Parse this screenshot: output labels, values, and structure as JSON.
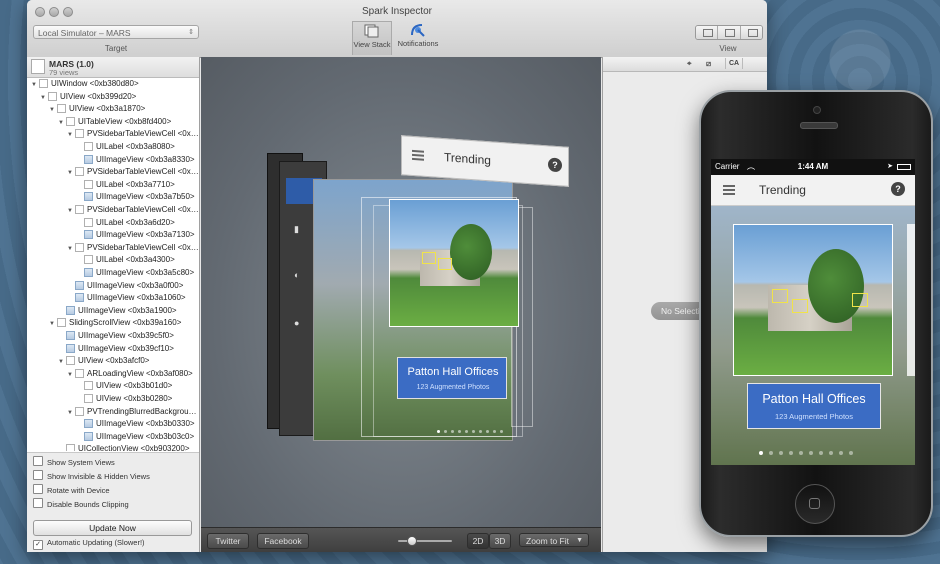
{
  "window": {
    "title": "Spark Inspector",
    "target_value": "Local Simulator – MARS",
    "target_label": "Target",
    "tool_view_stack": "View Stack",
    "tool_notifications": "Notifications",
    "view_label": "View"
  },
  "sidebar": {
    "app_name": "MARS (1.0)",
    "view_count": "79 views",
    "tree": [
      {
        "label": "UIWindow <0xb380d80>",
        "depth": 0,
        "expanded": true
      },
      {
        "label": "UIView <0xb399d20>",
        "depth": 1,
        "expanded": true
      },
      {
        "label": "UIView <0xb3a1870>",
        "depth": 2,
        "expanded": true
      },
      {
        "label": "UITableView <0xb8fd400>",
        "depth": 3,
        "expanded": true
      },
      {
        "label": "PVSidebarTableViewCell <0x…",
        "depth": 4,
        "expanded": true
      },
      {
        "label": "UILabel <0xb3a8080>",
        "depth": 5
      },
      {
        "label": "UIImageView <0xb3a8330>",
        "depth": 5,
        "img": true
      },
      {
        "label": "PVSidebarTableViewCell <0x…",
        "depth": 4,
        "expanded": true
      },
      {
        "label": "UILabel <0xb3a7710>",
        "depth": 5
      },
      {
        "label": "UIImageView <0xb3a7b50>",
        "depth": 5,
        "img": true
      },
      {
        "label": "PVSidebarTableViewCell <0x…",
        "depth": 4,
        "expanded": true
      },
      {
        "label": "UILabel <0xb3a6d20>",
        "depth": 5
      },
      {
        "label": "UIImageView <0xb3a7130>",
        "depth": 5,
        "img": true
      },
      {
        "label": "PVSidebarTableViewCell <0x…",
        "depth": 4,
        "expanded": true
      },
      {
        "label": "UILabel <0xb3a4300>",
        "depth": 5
      },
      {
        "label": "UIImageView <0xb3a5c80>",
        "depth": 5,
        "img": true
      },
      {
        "label": "UIImageView <0xb3a0f00>",
        "depth": 4,
        "img": true
      },
      {
        "label": "UIImageView <0xb3a1060>",
        "depth": 4,
        "img": true
      },
      {
        "label": "UIImageView <0xb3a1900>",
        "depth": 3,
        "img": true
      },
      {
        "label": "SlidingScrollView <0xb39a160>",
        "depth": 2,
        "expanded": true
      },
      {
        "label": "UIImageView <0xb39c5f0>",
        "depth": 3,
        "img": true
      },
      {
        "label": "UIImageView <0xb39cf10>",
        "depth": 3,
        "img": true
      },
      {
        "label": "UIView <0xb3afcf0>",
        "depth": 3,
        "expanded": true
      },
      {
        "label": "ARLoadingView <0xb3af080>",
        "depth": 4,
        "expanded": true
      },
      {
        "label": "UIView <0xb3b01d0>",
        "depth": 5
      },
      {
        "label": "UIView <0xb3b0280>",
        "depth": 5
      },
      {
        "label": "PVTrendingBlurredBackgrou…",
        "depth": 4,
        "expanded": true
      },
      {
        "label": "UIImageView <0xb3b0330>",
        "depth": 5,
        "img": true
      },
      {
        "label": "UIImageView <0xb3b03c0>",
        "depth": 5,
        "img": true
      },
      {
        "label": "UICollectionView <0xb903200>",
        "depth": 3
      }
    ],
    "options": [
      {
        "label": "Show System Views",
        "checked": false
      },
      {
        "label": "Show Invisible & Hidden Views",
        "checked": false
      },
      {
        "label": "Rotate with Device",
        "checked": false
      },
      {
        "label": "Disable Bounds Clipping",
        "checked": false
      }
    ],
    "update_button": "Update Now",
    "auto_update": {
      "label": "Automatic Updating (Slower!)",
      "checked": true
    }
  },
  "canvas": {
    "layer_title": "Trending",
    "photo_caption": "Patton Hall Offices",
    "photo_subcaption": "123 Augmented Photos",
    "help_glyph": "?"
  },
  "bottombar": {
    "twitter": "Twitter",
    "facebook": "Facebook",
    "mode_2d": "2D",
    "mode_3d": "3D",
    "zoom": "Zoom to Fit",
    "zoom_level": 0.2
  },
  "rightpane": {
    "ca_label": "CA",
    "no_selection": "No Selection"
  },
  "phone": {
    "carrier": "Carrier",
    "time": "1:44 AM",
    "nav_title": "Trending",
    "help_glyph": "?",
    "photo_caption": "Patton Hall Offices",
    "photo_subcaption": "123 Augmented Photos",
    "page_count": 10,
    "page_active": 0
  },
  "colors": {
    "caption_blue": "#3b6cc4",
    "nav_bg": "#f2f2f2",
    "canvas_bg": "#6b7279"
  }
}
